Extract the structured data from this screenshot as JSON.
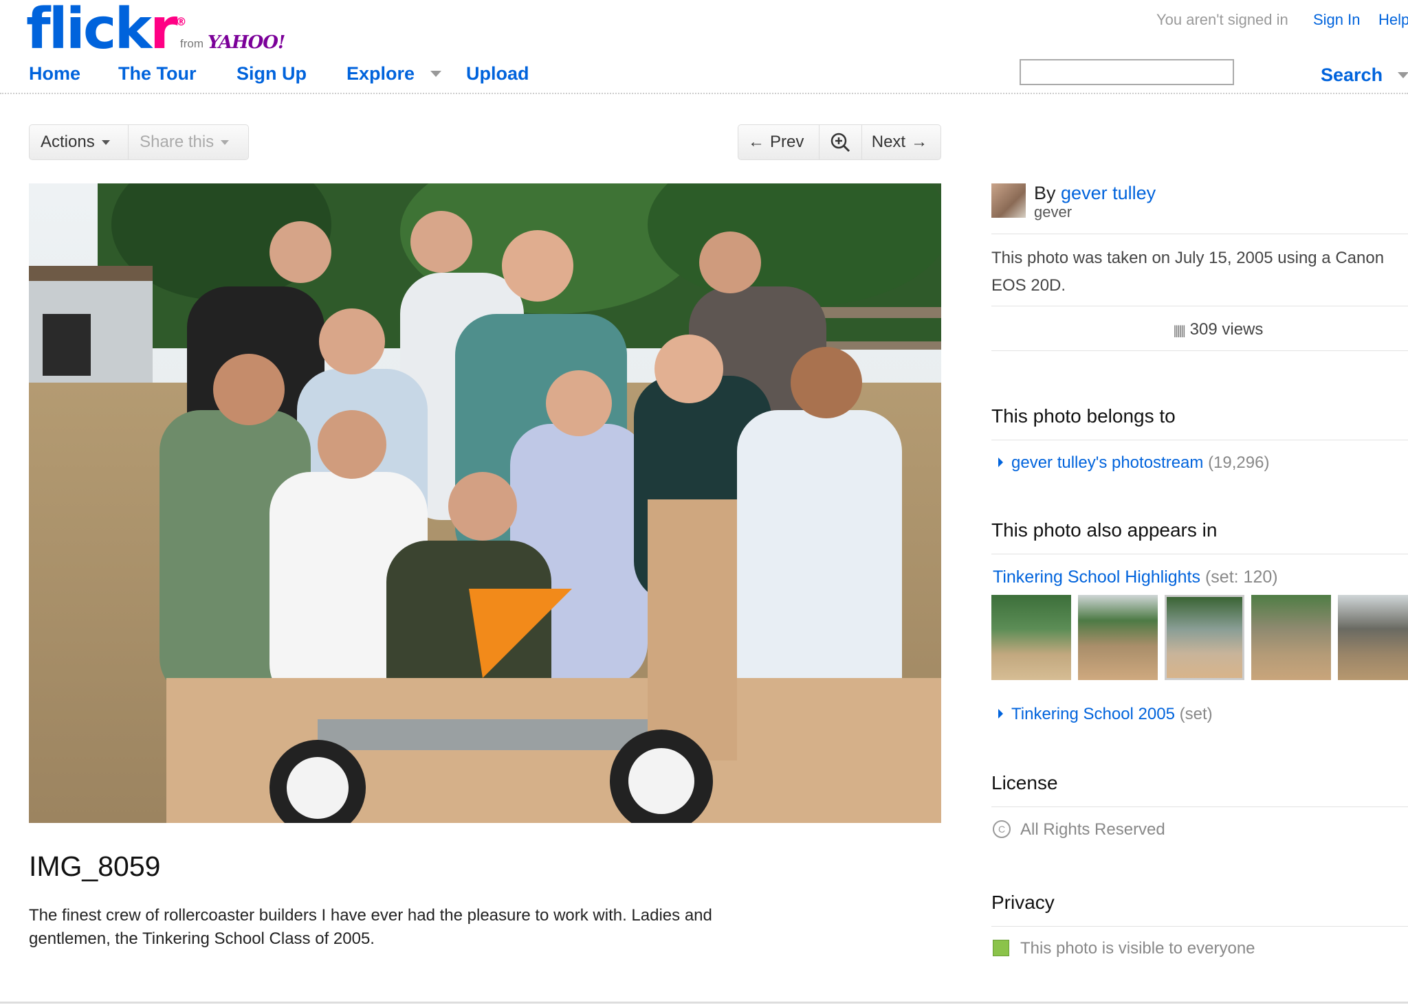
{
  "header": {
    "logo_main": "flick",
    "logo_r": "r",
    "logo_reg": "®",
    "from_text": "from",
    "yahoo_text": "YAHOO!",
    "nav": [
      "Home",
      "The Tour",
      "Sign Up",
      "Explore",
      "Upload"
    ],
    "signed_status": "You aren't signed in",
    "sign_in": "Sign In",
    "help": "Help",
    "search_value": "",
    "search_label": "Search"
  },
  "toolbar": {
    "actions": "Actions",
    "share": "Share this",
    "prev": "Prev",
    "next": "Next"
  },
  "photo": {
    "title": "IMG_8059",
    "description": "The finest crew of rollercoaster builders I have ever had the pleasure to work with. Ladies and gentlemen, the Tinkering School Class of 2005."
  },
  "sidebar": {
    "by_prefix": "By",
    "owner_name": "gever tulley",
    "owner_username": "gever",
    "taken_text": "This photo was taken on July 15, 2005 using a Canon EOS 20D.",
    "views": "309 views",
    "belongs_heading": "This photo belongs to",
    "photostream_link": "gever tulley's photostream",
    "photostream_count": "(19,296)",
    "appears_heading": "This photo also appears in",
    "set1_name": "Tinkering School Highlights",
    "set1_meta": "(set: 120)",
    "set2_name": "Tinkering School 2005",
    "set2_meta": "(set)",
    "license_heading": "License",
    "license_text": "All Rights Reserved",
    "privacy_heading": "Privacy",
    "privacy_text": "This photo is visible to everyone",
    "privacy_color": "#8bc34a"
  },
  "colors": {
    "link": "#0063dc",
    "brand_pink": "#ff0084",
    "yahoo_purple": "#7b0099"
  }
}
